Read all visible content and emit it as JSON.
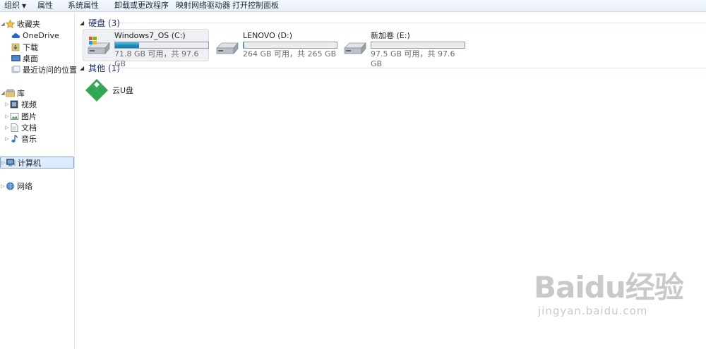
{
  "toolbar": {
    "buttons": [
      "组织",
      "属性",
      "系统属性",
      "卸载或更改程序",
      "映射网络驱动器",
      "打开控制面板"
    ]
  },
  "nav": {
    "favorites": "收藏夹",
    "onedrive": "OneDrive",
    "downloads": "下载",
    "desktop": "桌面",
    "recent": "最近访问的位置",
    "libraries": "库",
    "videos": "视频",
    "pictures": "图片",
    "documents": "文档",
    "music": "音乐",
    "computer": "计算机",
    "network": "网络"
  },
  "groups": {
    "hard_disks": "硬盘 (3)",
    "other": "其他 (1)"
  },
  "drives": [
    {
      "name": "Windows7_OS (C:)",
      "info": "71.8 GB 可用，共 97.6 GB",
      "used_fraction": 0.26
    },
    {
      "name": "LENOVO (D:)",
      "info": "264 GB 可用，共 265 GB",
      "used_fraction": 0.004
    },
    {
      "name": "新加卷 (E:)",
      "info": "97.5 GB 可用，共 97.6 GB",
      "used_fraction": 0.001
    }
  ],
  "other_items": [
    {
      "name": "云U盘"
    }
  ],
  "watermark": {
    "logo": "Baidu经验",
    "url": "jingyan.baidu.com"
  },
  "colors": {
    "accent_selection": "#dcecfc",
    "group_header": "#1e3287",
    "bar_fill": "#1e8fbe",
    "cloud_green": "#2fa84f"
  }
}
